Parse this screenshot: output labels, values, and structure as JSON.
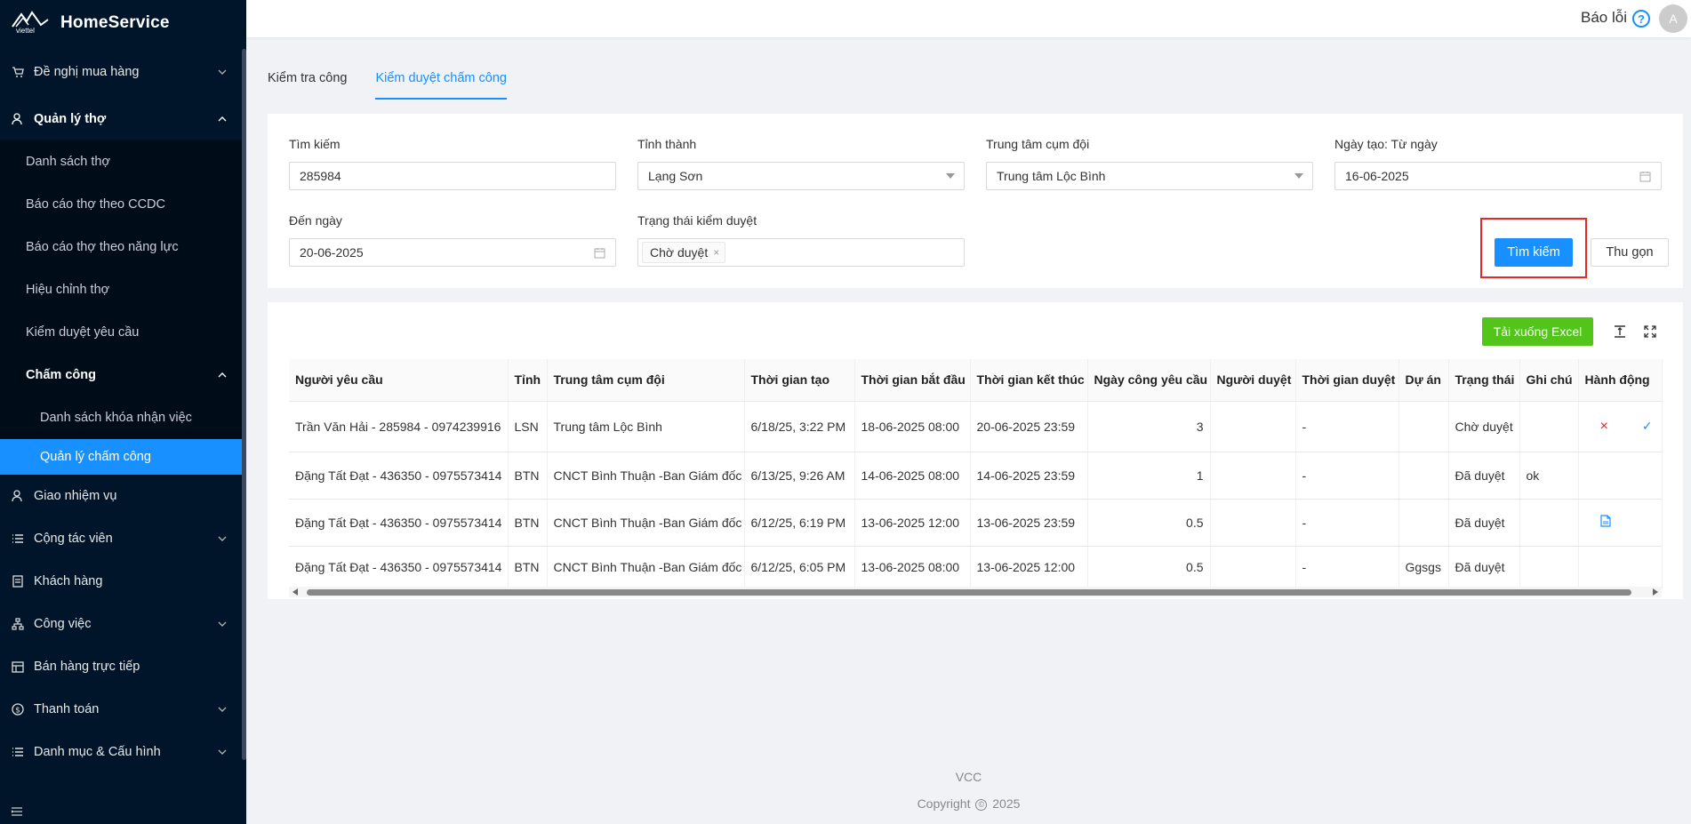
{
  "app": {
    "brand": "HomeService",
    "logo_text": "viettel"
  },
  "header": {
    "report_label": "Báo lỗi",
    "help_glyph": "?",
    "avatar_letter": "A"
  },
  "sidebar": {
    "items": [
      {
        "label": "Đề nghị mua hàng",
        "icon": "cart-icon"
      },
      {
        "label": "Quản lý thợ",
        "icon": "worker-icon"
      },
      {
        "label": "Danh sách thợ"
      },
      {
        "label": "Báo cáo thợ theo CCDC"
      },
      {
        "label": "Báo cáo thợ theo năng lực"
      },
      {
        "label": "Hiệu chỉnh thợ"
      },
      {
        "label": "Kiểm duyệt yêu cầu"
      },
      {
        "label": "Chấm công"
      },
      {
        "label": "Danh sách khóa nhận việc"
      },
      {
        "label": "Quản lý chấm công"
      },
      {
        "label": "Giao nhiệm vụ",
        "icon": "worker-icon"
      },
      {
        "label": "Cộng tác viên",
        "icon": "list-icon"
      },
      {
        "label": "Khách hàng",
        "icon": "document-icon"
      },
      {
        "label": "Công việc",
        "icon": "hierarchy-icon"
      },
      {
        "label": "Bán hàng trực tiếp",
        "icon": "store-icon"
      },
      {
        "label": "Thanh toán",
        "icon": "dollar-icon"
      },
      {
        "label": "Danh mục & Cấu hình",
        "icon": "list-icon"
      }
    ]
  },
  "tabs": [
    {
      "label": "Kiểm tra công"
    },
    {
      "label": "Kiểm duyệt chấm công"
    }
  ],
  "filters": {
    "search": {
      "label": "Tìm kiếm",
      "value": "285984"
    },
    "province": {
      "label": "Tỉnh thành",
      "value": "Lạng Sơn"
    },
    "center": {
      "label": "Trung tâm cụm đội",
      "value": "Trung tâm Lộc Bình"
    },
    "from_date": {
      "label": "Ngày tạo: Từ ngày",
      "value": "16-06-2025"
    },
    "to_date": {
      "label": "Đến ngày",
      "value": "20-06-2025"
    },
    "status": {
      "label": "Trạng thái kiểm duyệt",
      "tag": "Chờ duyệt",
      "tag_remove": "×"
    },
    "search_button": "Tìm kiếm",
    "collapse_button": "Thu gọn"
  },
  "table": {
    "excel_button": "Tải xuống Excel",
    "columns": [
      "Người yêu cầu",
      "Tỉnh",
      "Trung tâm cụm đội",
      "Thời gian tạo",
      "Thời gian bắt đầu",
      "Thời gian kết thúc",
      "Ngày công yêu cầu",
      "Người duyệt",
      "Thời gian duyệt",
      "Dự án",
      "Trạng thái",
      "Ghi chú",
      "Hành động"
    ],
    "rows": [
      {
        "requester": "Trần Văn Hải - 285984 - 0974239916",
        "province": "LSN",
        "center": "Trung tâm Lộc Bình",
        "created": "6/18/25, 3:22 PM",
        "start": "18-06-2025 08:00",
        "end": "20-06-2025 23:59",
        "days": "3",
        "approver": "",
        "approved_at": "-",
        "project": "",
        "status": "Chờ duyệt",
        "note": "",
        "reject": "×",
        "approve": "✓"
      },
      {
        "requester": "Đặng Tất Đạt - 436350 - 0975573414",
        "province": "BTN",
        "center": "CNCT Bình Thuận -Ban Giám đốc",
        "created": "6/13/25, 9:26 AM",
        "start": "14-06-2025 08:00",
        "end": "14-06-2025 23:59",
        "days": "1",
        "approver": "",
        "approved_at": "-",
        "project": "",
        "status": "Đã duyệt",
        "note": "ok"
      },
      {
        "requester": "Đặng Tất Đạt - 436350 - 0975573414",
        "province": "BTN",
        "center": "CNCT Bình Thuận -Ban Giám đốc",
        "created": "6/12/25, 6:19 PM",
        "start": "13-06-2025 12:00",
        "end": "13-06-2025 23:59",
        "days": "0.5",
        "approver": "",
        "approved_at": "-",
        "project": "",
        "status": "Đã duyệt",
        "note": ""
      },
      {
        "requester": "Đặng Tất Đạt - 436350 - 0975573414",
        "province": "BTN",
        "center": "CNCT Bình Thuận -Ban Giám đốc",
        "created": "6/12/25, 6:05 PM",
        "start": "13-06-2025 08:00",
        "end": "13-06-2025 12:00",
        "days": "0.5",
        "approver": "",
        "approved_at": "-",
        "project": "Ggsgs",
        "status": "Đã duyệt",
        "note": ""
      }
    ]
  },
  "footer": {
    "org": "VCC",
    "copyright_pre": "Copyright",
    "copyright_symbol": "©",
    "year": "2025"
  }
}
